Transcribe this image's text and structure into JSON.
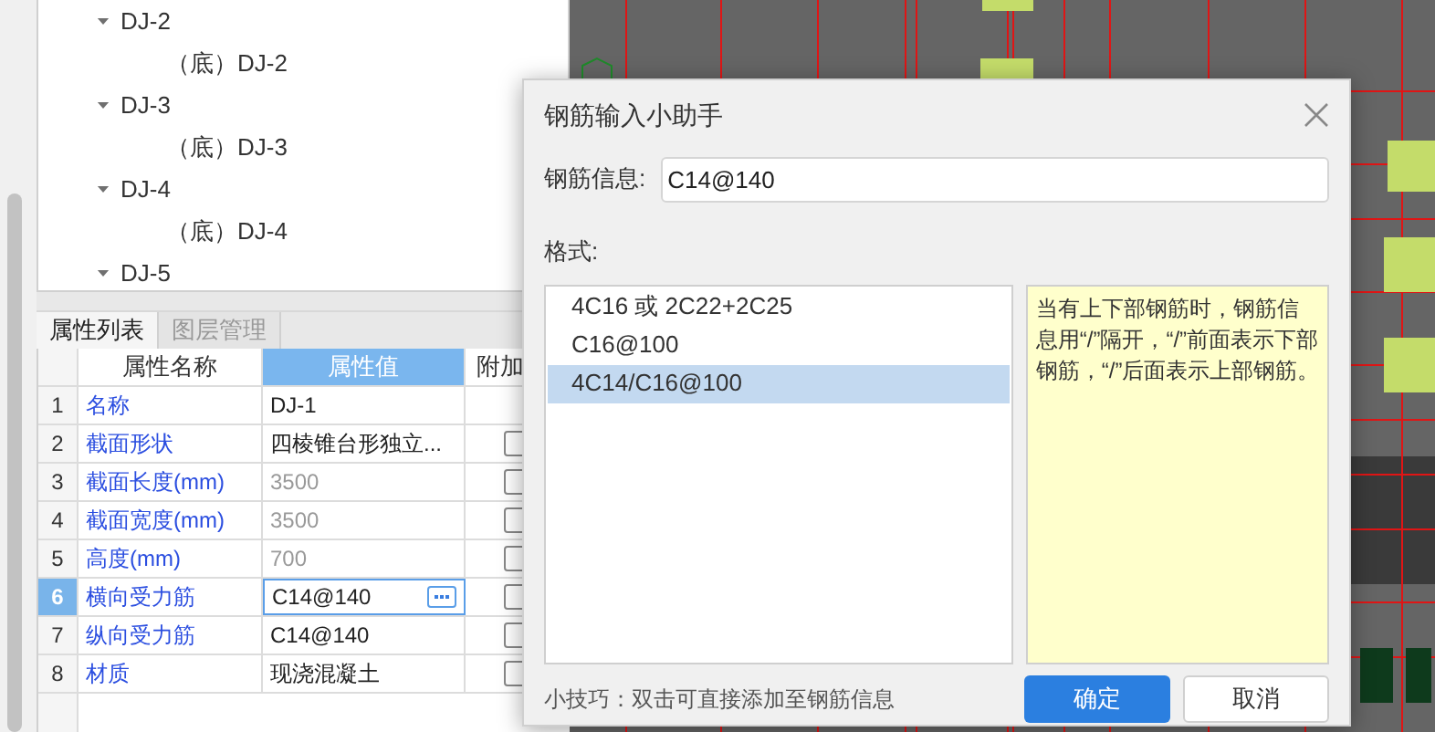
{
  "tree": [
    {
      "label": "DJ-2",
      "expanded": true,
      "children": [
        {
          "label": "（底）DJ-2"
        }
      ]
    },
    {
      "label": "DJ-3",
      "expanded": true,
      "children": [
        {
          "label": "（底）DJ-3"
        }
      ]
    },
    {
      "label": "DJ-4",
      "expanded": true,
      "children": [
        {
          "label": "（底）DJ-4"
        }
      ]
    },
    {
      "label": "DJ-5",
      "expanded": true
    }
  ],
  "panel_tabs": [
    {
      "label": "属性列表",
      "selected": true
    },
    {
      "label": "图层管理",
      "selected": false
    }
  ],
  "table": {
    "columns": [
      {
        "label": "属性名称",
        "selected": false
      },
      {
        "label": "属性值",
        "selected": true
      },
      {
        "label": "附加",
        "selected": false
      }
    ],
    "rows": [
      {
        "num": "1",
        "name": "名称",
        "value": "DJ-1",
        "disabled": false,
        "selected": false,
        "editing": false
      },
      {
        "num": "2",
        "name": "截面形状",
        "value": "四棱锥台形独立...",
        "disabled": false,
        "selected": false,
        "editing": false,
        "checked": false
      },
      {
        "num": "3",
        "name": "截面长度(mm)",
        "value": "3500",
        "disabled": true,
        "selected": false,
        "editing": false,
        "checked": false
      },
      {
        "num": "4",
        "name": "截面宽度(mm)",
        "value": "3500",
        "disabled": true,
        "selected": false,
        "editing": false,
        "checked": false
      },
      {
        "num": "5",
        "name": "高度(mm)",
        "value": "700",
        "disabled": true,
        "selected": false,
        "editing": false,
        "checked": false
      },
      {
        "num": "6",
        "name": "横向受力筋",
        "value": "C14@140",
        "disabled": false,
        "selected": true,
        "editing": true,
        "checked": false
      },
      {
        "num": "7",
        "name": "纵向受力筋",
        "value": "C14@140",
        "disabled": false,
        "selected": false,
        "editing": false,
        "checked": false
      },
      {
        "num": "8",
        "name": "材质",
        "value": "现浇混凝土",
        "disabled": false,
        "selected": false,
        "editing": false,
        "checked": false
      }
    ]
  },
  "dialog": {
    "title": "钢筋输入小助手",
    "field_label": "钢筋信息:",
    "field_value": "C14@140",
    "format_label": "格式:",
    "formats": [
      {
        "label": "4C16 或 2C22+2C25",
        "selected": false
      },
      {
        "label": "C16@100",
        "selected": false
      },
      {
        "label": "4C14/C16@100",
        "selected": true
      }
    ],
    "hint": "当有上下部钢筋时，钢筋信息用“/”隔开，“/”前面表示下部钢筋，“/”后面表示上部钢筋。",
    "tip": "小技巧：双击可直接添加至钢筋信息",
    "buttons": [
      {
        "label": "确定",
        "kind": "primary"
      },
      {
        "label": "取消",
        "kind": "secondary"
      }
    ]
  }
}
